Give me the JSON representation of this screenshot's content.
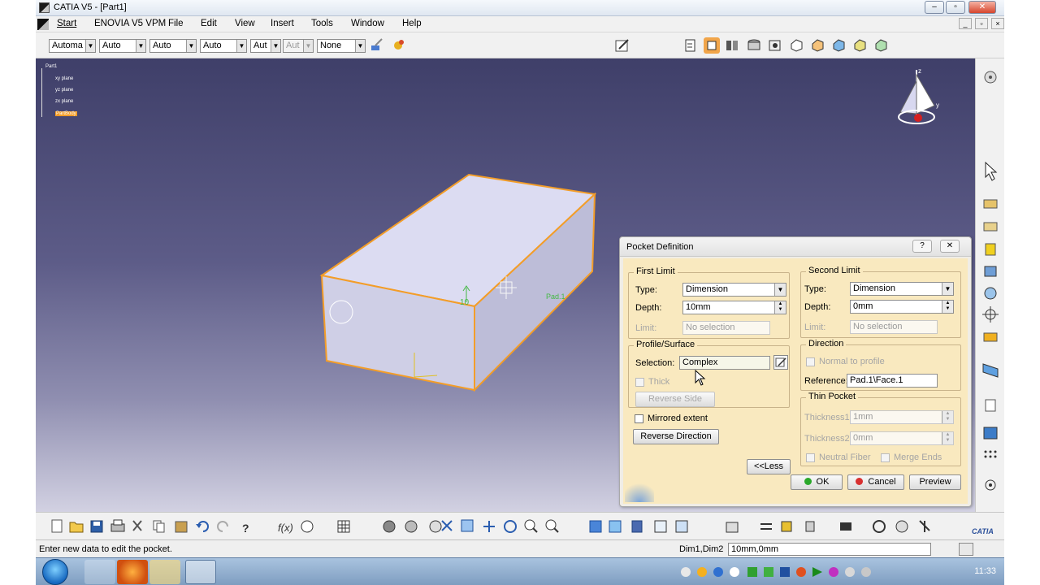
{
  "window": {
    "title": "CATIA V5 - [Part1]"
  },
  "menu": [
    "Start",
    "ENOVIA V5 VPM",
    "File",
    "Edit",
    "View",
    "Insert",
    "Tools",
    "Window",
    "Help"
  ],
  "toolbar": {
    "combos": [
      {
        "value": "Automa",
        "disabled": false
      },
      {
        "value": "Auto",
        "disabled": false
      },
      {
        "value": "Auto",
        "disabled": false
      },
      {
        "value": "Auto",
        "disabled": false
      },
      {
        "value": "Aut",
        "disabled": false
      },
      {
        "value": "Aut",
        "disabled": true
      },
      {
        "value": "None",
        "disabled": false
      }
    ]
  },
  "tree": {
    "root": "Part1",
    "items": [
      "xy plane",
      "yz plane",
      "zx plane",
      "PartBody"
    ]
  },
  "viewport": {
    "annotations": {
      "depth_value": "10",
      "profile_label": "Pad.1"
    }
  },
  "dialog": {
    "title": "Pocket Definition",
    "first_limit": {
      "legend": "First Limit",
      "type_label": "Type:",
      "type_value": "Dimension",
      "depth_label": "Depth:",
      "depth_value": "10mm",
      "limit_label": "Limit:",
      "limit_value": "No selection"
    },
    "second_limit": {
      "legend": "Second Limit",
      "type_label": "Type:",
      "type_value": "Dimension",
      "depth_label": "Depth:",
      "depth_value": "0mm",
      "limit_label": "Limit:",
      "limit_value": "No selection"
    },
    "profile": {
      "legend": "Profile/Surface",
      "selection_label": "Selection:",
      "selection_value": "Complex",
      "thick_label": "Thick",
      "reverse_side": "Reverse Side"
    },
    "direction": {
      "legend": "Direction",
      "normal_label": "Normal to profile",
      "reference_label": "Reference:",
      "reference_value": "Pad.1\\Face.1"
    },
    "thin_pocket": {
      "legend": "Thin Pocket",
      "thickness1_label": "Thickness1:",
      "thickness1_value": "1mm",
      "thickness2_label": "Thickness2:",
      "thickness2_value": "0mm",
      "neutral_fiber": "Neutral Fiber",
      "merge_ends": "Merge Ends"
    },
    "mirrored_extent": "Mirrored extent",
    "reverse_direction": "Reverse Direction",
    "less": "<<Less",
    "ok": "OK",
    "cancel": "Cancel",
    "preview": "Preview"
  },
  "status": {
    "message": "Enter new data to edit the pocket.",
    "param_label": "Dim1,Dim2",
    "param_value": "10mm,0mm"
  },
  "taskbar": {
    "clock": "11:33"
  },
  "colors": {
    "viewport_top": "#3f3f69",
    "part_face": "#dcdcf2",
    "edge_highlight": "#f39d28",
    "dialog_bg": "#f9e9bf"
  }
}
